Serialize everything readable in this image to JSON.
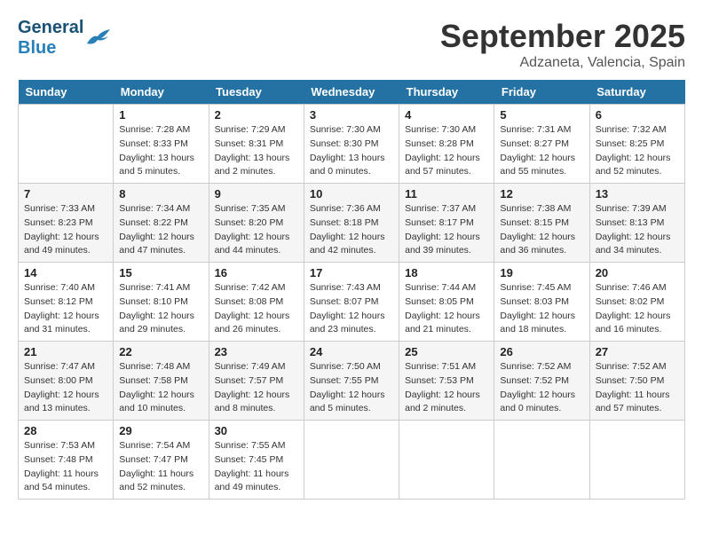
{
  "header": {
    "logo_general": "General",
    "logo_blue": "Blue",
    "month_title": "September 2025",
    "location": "Adzaneta, Valencia, Spain"
  },
  "weekdays": [
    "Sunday",
    "Monday",
    "Tuesday",
    "Wednesday",
    "Thursday",
    "Friday",
    "Saturday"
  ],
  "weeks": [
    [
      {
        "day": "",
        "sunrise": "",
        "sunset": "",
        "daylight": ""
      },
      {
        "day": "1",
        "sunrise": "Sunrise: 7:28 AM",
        "sunset": "Sunset: 8:33 PM",
        "daylight": "Daylight: 13 hours and 5 minutes."
      },
      {
        "day": "2",
        "sunrise": "Sunrise: 7:29 AM",
        "sunset": "Sunset: 8:31 PM",
        "daylight": "Daylight: 13 hours and 2 minutes."
      },
      {
        "day": "3",
        "sunrise": "Sunrise: 7:30 AM",
        "sunset": "Sunset: 8:30 PM",
        "daylight": "Daylight: 13 hours and 0 minutes."
      },
      {
        "day": "4",
        "sunrise": "Sunrise: 7:30 AM",
        "sunset": "Sunset: 8:28 PM",
        "daylight": "Daylight: 12 hours and 57 minutes."
      },
      {
        "day": "5",
        "sunrise": "Sunrise: 7:31 AM",
        "sunset": "Sunset: 8:27 PM",
        "daylight": "Daylight: 12 hours and 55 minutes."
      },
      {
        "day": "6",
        "sunrise": "Sunrise: 7:32 AM",
        "sunset": "Sunset: 8:25 PM",
        "daylight": "Daylight: 12 hours and 52 minutes."
      }
    ],
    [
      {
        "day": "7",
        "sunrise": "Sunrise: 7:33 AM",
        "sunset": "Sunset: 8:23 PM",
        "daylight": "Daylight: 12 hours and 49 minutes."
      },
      {
        "day": "8",
        "sunrise": "Sunrise: 7:34 AM",
        "sunset": "Sunset: 8:22 PM",
        "daylight": "Daylight: 12 hours and 47 minutes."
      },
      {
        "day": "9",
        "sunrise": "Sunrise: 7:35 AM",
        "sunset": "Sunset: 8:20 PM",
        "daylight": "Daylight: 12 hours and 44 minutes."
      },
      {
        "day": "10",
        "sunrise": "Sunrise: 7:36 AM",
        "sunset": "Sunset: 8:18 PM",
        "daylight": "Daylight: 12 hours and 42 minutes."
      },
      {
        "day": "11",
        "sunrise": "Sunrise: 7:37 AM",
        "sunset": "Sunset: 8:17 PM",
        "daylight": "Daylight: 12 hours and 39 minutes."
      },
      {
        "day": "12",
        "sunrise": "Sunrise: 7:38 AM",
        "sunset": "Sunset: 8:15 PM",
        "daylight": "Daylight: 12 hours and 36 minutes."
      },
      {
        "day": "13",
        "sunrise": "Sunrise: 7:39 AM",
        "sunset": "Sunset: 8:13 PM",
        "daylight": "Daylight: 12 hours and 34 minutes."
      }
    ],
    [
      {
        "day": "14",
        "sunrise": "Sunrise: 7:40 AM",
        "sunset": "Sunset: 8:12 PM",
        "daylight": "Daylight: 12 hours and 31 minutes."
      },
      {
        "day": "15",
        "sunrise": "Sunrise: 7:41 AM",
        "sunset": "Sunset: 8:10 PM",
        "daylight": "Daylight: 12 hours and 29 minutes."
      },
      {
        "day": "16",
        "sunrise": "Sunrise: 7:42 AM",
        "sunset": "Sunset: 8:08 PM",
        "daylight": "Daylight: 12 hours and 26 minutes."
      },
      {
        "day": "17",
        "sunrise": "Sunrise: 7:43 AM",
        "sunset": "Sunset: 8:07 PM",
        "daylight": "Daylight: 12 hours and 23 minutes."
      },
      {
        "day": "18",
        "sunrise": "Sunrise: 7:44 AM",
        "sunset": "Sunset: 8:05 PM",
        "daylight": "Daylight: 12 hours and 21 minutes."
      },
      {
        "day": "19",
        "sunrise": "Sunrise: 7:45 AM",
        "sunset": "Sunset: 8:03 PM",
        "daylight": "Daylight: 12 hours and 18 minutes."
      },
      {
        "day": "20",
        "sunrise": "Sunrise: 7:46 AM",
        "sunset": "Sunset: 8:02 PM",
        "daylight": "Daylight: 12 hours and 16 minutes."
      }
    ],
    [
      {
        "day": "21",
        "sunrise": "Sunrise: 7:47 AM",
        "sunset": "Sunset: 8:00 PM",
        "daylight": "Daylight: 12 hours and 13 minutes."
      },
      {
        "day": "22",
        "sunrise": "Sunrise: 7:48 AM",
        "sunset": "Sunset: 7:58 PM",
        "daylight": "Daylight: 12 hours and 10 minutes."
      },
      {
        "day": "23",
        "sunrise": "Sunrise: 7:49 AM",
        "sunset": "Sunset: 7:57 PM",
        "daylight": "Daylight: 12 hours and 8 minutes."
      },
      {
        "day": "24",
        "sunrise": "Sunrise: 7:50 AM",
        "sunset": "Sunset: 7:55 PM",
        "daylight": "Daylight: 12 hours and 5 minutes."
      },
      {
        "day": "25",
        "sunrise": "Sunrise: 7:51 AM",
        "sunset": "Sunset: 7:53 PM",
        "daylight": "Daylight: 12 hours and 2 minutes."
      },
      {
        "day": "26",
        "sunrise": "Sunrise: 7:52 AM",
        "sunset": "Sunset: 7:52 PM",
        "daylight": "Daylight: 12 hours and 0 minutes."
      },
      {
        "day": "27",
        "sunrise": "Sunrise: 7:52 AM",
        "sunset": "Sunset: 7:50 PM",
        "daylight": "Daylight: 11 hours and 57 minutes."
      }
    ],
    [
      {
        "day": "28",
        "sunrise": "Sunrise: 7:53 AM",
        "sunset": "Sunset: 7:48 PM",
        "daylight": "Daylight: 11 hours and 54 minutes."
      },
      {
        "day": "29",
        "sunrise": "Sunrise: 7:54 AM",
        "sunset": "Sunset: 7:47 PM",
        "daylight": "Daylight: 11 hours and 52 minutes."
      },
      {
        "day": "30",
        "sunrise": "Sunrise: 7:55 AM",
        "sunset": "Sunset: 7:45 PM",
        "daylight": "Daylight: 11 hours and 49 minutes."
      },
      {
        "day": "",
        "sunrise": "",
        "sunset": "",
        "daylight": ""
      },
      {
        "day": "",
        "sunrise": "",
        "sunset": "",
        "daylight": ""
      },
      {
        "day": "",
        "sunrise": "",
        "sunset": "",
        "daylight": ""
      },
      {
        "day": "",
        "sunrise": "",
        "sunset": "",
        "daylight": ""
      }
    ]
  ]
}
